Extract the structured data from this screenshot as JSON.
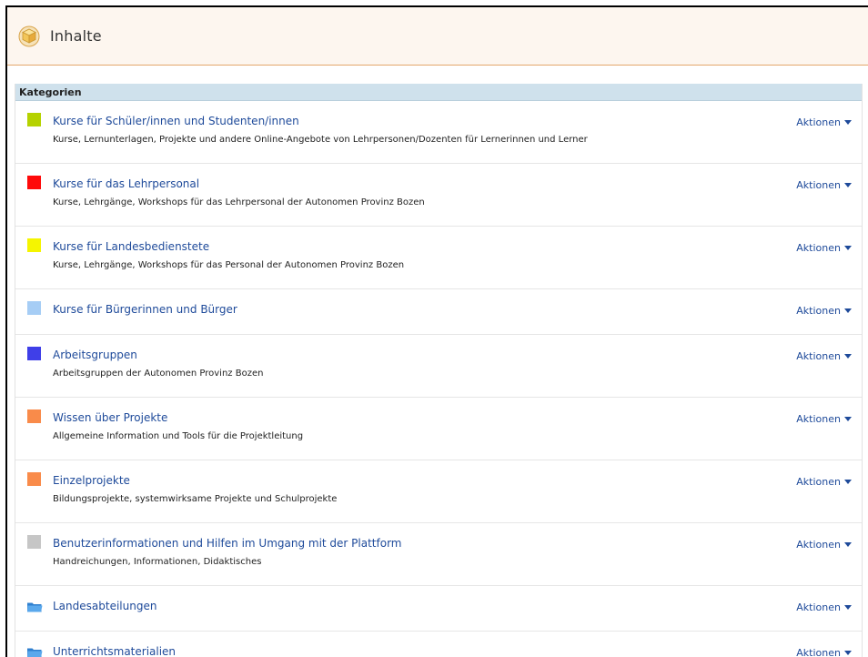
{
  "header": {
    "title": "Inhalte"
  },
  "panel": {
    "heading": "Kategorien"
  },
  "actions_label": "Aktionen",
  "categories": [
    {
      "title": "Kurse für Schüler/innen und Studenten/innen",
      "description": "Kurse, Lernunterlagen, Projekte und andere Online-Angebote von Lehrpersonen/Dozenten für Lernerinnen und Lerner",
      "color": "#b5d200",
      "icon": "color-square"
    },
    {
      "title": "Kurse für das Lehrpersonal",
      "description": "Kurse, Lehrgänge, Workshops für das Lehrpersonal der Autonomen Provinz Bozen",
      "color": "#ff0a0a",
      "icon": "color-square"
    },
    {
      "title": "Kurse für Landesbedienstete",
      "description": "Kurse, Lehrgänge, Workshops für das Personal der Autonomen Provinz Bozen",
      "color": "#f5f500",
      "icon": "color-square"
    },
    {
      "title": "Kurse für Bürgerinnen und Bürger",
      "description": "",
      "color": "#a6cdf5",
      "icon": "color-square"
    },
    {
      "title": "Arbeitsgruppen",
      "description": "Arbeitsgruppen der Autonomen Provinz Bozen",
      "color": "#3f3fe8",
      "icon": "color-square"
    },
    {
      "title": "Wissen über Projekte",
      "description": "Allgemeine Information und Tools für die Projektleitung",
      "color": "#f98b4a",
      "icon": "color-square"
    },
    {
      "title": "Einzelprojekte",
      "description": "Bildungsprojekte, systemwirksame Projekte und Schulprojekte",
      "color": "#f98b4a",
      "icon": "color-square"
    },
    {
      "title": "Benutzerinformationen und Hilfen im Umgang mit der Plattform",
      "description": "Handreichungen, Informationen, Didaktisches",
      "color": "#c6c6c6",
      "icon": "color-square"
    },
    {
      "title": "Landesabteilungen",
      "description": "",
      "color": "#3d8fd6",
      "icon": "folder-icon"
    },
    {
      "title": "Unterrichtsmaterialien",
      "description": "",
      "color": "#3d8fd6",
      "icon": "folder-icon"
    }
  ]
}
